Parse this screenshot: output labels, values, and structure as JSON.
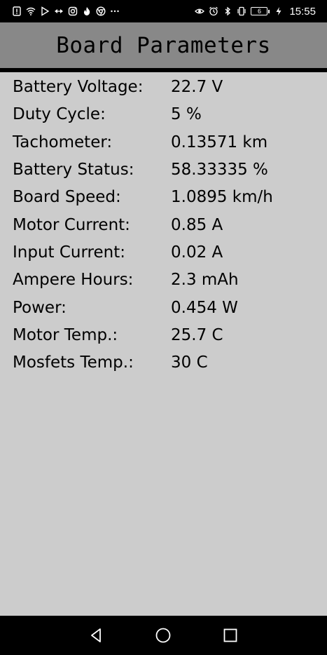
{
  "status_bar": {
    "left_icons": [
      "alert-icon",
      "wifi-icon",
      "play-store-icon",
      "arrows-icon",
      "instagram-icon",
      "flame-icon",
      "chrome-icon",
      "more-dots-icon"
    ],
    "right_icons": [
      "eye-icon",
      "alarm-icon",
      "bluetooth-icon",
      "vibrate-icon"
    ],
    "battery_level": "6",
    "time": "15:55"
  },
  "header": {
    "title": "Board Parameters"
  },
  "params": [
    {
      "label": "Battery Voltage:",
      "value": "22.7 V"
    },
    {
      "label": "Duty Cycle:",
      "value": "5 %"
    },
    {
      "label": "Tachometer:",
      "value": "0.13571 km"
    },
    {
      "label": "Battery Status:",
      "value": "58.33335 %"
    },
    {
      "label": "Board Speed:",
      "value": "1.0895 km/h"
    },
    {
      "label": "Motor Current:",
      "value": "0.85 A"
    },
    {
      "label": "Input Current:",
      "value": "0.02 A"
    },
    {
      "label": "Ampere Hours:",
      "value": "2.3 mAh"
    },
    {
      "label": "Power:",
      "value": "0.454 W"
    },
    {
      "label": "Motor Temp.:",
      "value": "25.7 C"
    },
    {
      "label": "Mosfets Temp.:",
      "value": "30 C"
    }
  ],
  "nav_bar": {
    "buttons": [
      "back-icon",
      "home-icon",
      "recents-icon"
    ]
  },
  "colors": {
    "background": "#cccccc",
    "header": "#888888",
    "bars": "#000000"
  }
}
